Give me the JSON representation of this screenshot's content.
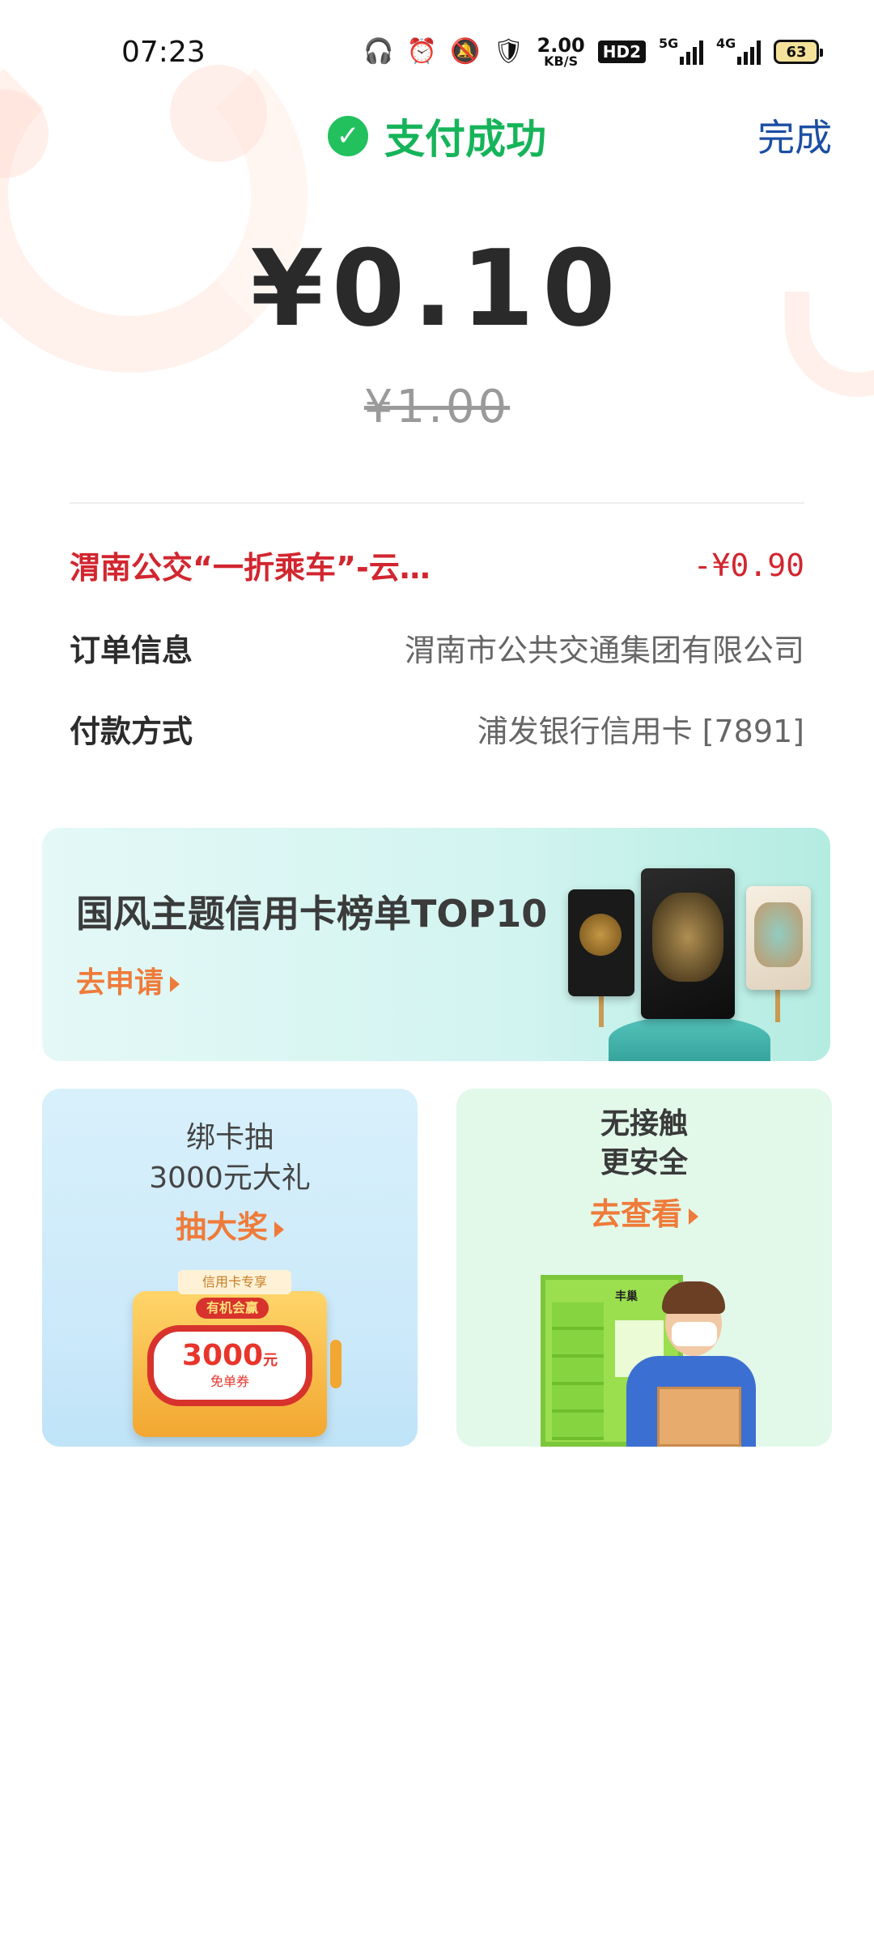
{
  "status_bar": {
    "time": "07:23",
    "network_speed_value": "2.00",
    "network_speed_unit": "KB/S",
    "hd_label": "HD2",
    "sim1_label": "5G",
    "sim2_label": "4G",
    "battery_level": "63",
    "icons": [
      "headphones-icon",
      "alarm-icon",
      "mute-icon",
      "shield-icon",
      "hd-icon",
      "signal-icon",
      "battery-icon"
    ]
  },
  "header": {
    "title": "支付成功",
    "done_label": "完成",
    "success_color": "#16b45a"
  },
  "payment": {
    "amount": "¥0.10",
    "original_amount": "¥1.00"
  },
  "details": {
    "discount_label": "渭南公交“一折乘车”-云…",
    "discount_value": "-¥0.90",
    "order_label": "订单信息",
    "order_value": "渭南市公共交通集团有限公司",
    "payment_label": "付款方式",
    "payment_value": "浦发银行信用卡 [7891]"
  },
  "banners": {
    "top": {
      "title": "国风主题信用卡榜单TOP10",
      "cta": "去申请"
    },
    "left": {
      "line1": "绑卡抽",
      "line2": "3000元大礼",
      "cta": "抽大奖",
      "tag": "信用卡专享",
      "badge": "有机会赢",
      "prize_amount": "3000",
      "prize_unit": "元",
      "prize_desc": "免单券"
    },
    "right": {
      "line1": "无接触",
      "line2": "更安全",
      "cta": "去查看",
      "locker_brand": "丰巢"
    }
  }
}
